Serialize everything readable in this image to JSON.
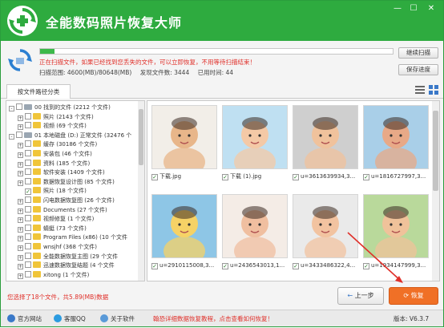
{
  "app": {
    "title": "全能数码照片恢复大师",
    "min_label": "—",
    "max_label": "☐",
    "close_label": "✕"
  },
  "scan": {
    "progress": 0.04,
    "status": "正在扫描文件，如果已经找到您丢失的文件，可以立即恢复，不用等待扫描结束！",
    "range": "扫描范围: 4600(MB)/80648(MB)",
    "found": "发现文件数: 3444",
    "elapsed": "已用时间: 44",
    "continue_label": "继续扫描",
    "save_label": "保存进度"
  },
  "tab": {
    "label": "按文件路径分类"
  },
  "tree": [
    {
      "label": "00 找到的文件  (2212 个文件)",
      "level": 0,
      "kind": "drive",
      "exp": "-"
    },
    {
      "label": "照片     (2143 个文件)",
      "level": 1,
      "kind": "folder",
      "exp": "+"
    },
    {
      "label": "视频     (69 个文件)",
      "level": 1,
      "kind": "folder",
      "exp": "+"
    },
    {
      "label": "01 本地磁盘 (D:) 正常文件  (32476 个",
      "level": 0,
      "kind": "drive",
      "exp": "-"
    },
    {
      "label": "缓存     (30186 个文件)",
      "level": 1,
      "kind": "folder",
      "exp": "+"
    },
    {
      "label": "安装包    (46 个文件)",
      "level": 1,
      "kind": "folder",
      "exp": "+"
    },
    {
      "label": "资料     (185 个文件)",
      "level": 1,
      "kind": "folder",
      "exp": "+"
    },
    {
      "label": "软件安装   (1409 个文件)",
      "level": 1,
      "kind": "folder",
      "exp": "+"
    },
    {
      "label": "数据恢复设计图   (85 个文件)",
      "level": 1,
      "kind": "folder",
      "exp": "+"
    },
    {
      "label": "照片     (18 个文件)",
      "level": 1,
      "kind": "folder",
      "exp": "",
      "checked": true
    },
    {
      "label": "闪电数据恢复图   (26 个文件)",
      "level": 1,
      "kind": "folder",
      "exp": "+"
    },
    {
      "label": "Documents    (27 个文件)",
      "level": 1,
      "kind": "folder",
      "exp": "+"
    },
    {
      "label": "视频修复    (1 个文件)",
      "level": 1,
      "kind": "folder",
      "exp": "+"
    },
    {
      "label": "蜻蜓     (73 个文件)",
      "level": 1,
      "kind": "folder",
      "exp": "+"
    },
    {
      "label": "Program Files (x86)   (10 个文件",
      "level": 1,
      "kind": "folder",
      "exp": "+"
    },
    {
      "label": "wnsjhf    (368 个文件)",
      "level": 1,
      "kind": "folder",
      "exp": "+"
    },
    {
      "label": "全能数据恢复主图   (29 个文件",
      "level": 1,
      "kind": "folder",
      "exp": "+"
    },
    {
      "label": "迅速数据恢复结题   (4 个文件",
      "level": 1,
      "kind": "folder",
      "exp": "+"
    },
    {
      "label": "xitong    (1 个文件)",
      "level": 1,
      "kind": "folder",
      "exp": "+"
    }
  ],
  "files": [
    {
      "name": "下载.jpg",
      "bg": "#f2eee8",
      "fg": "#e8b68a"
    },
    {
      "name": "下载 (1).jpg",
      "bg": "#bfe0f2",
      "fg": "#f4c9a6"
    },
    {
      "name": "u=3613639934,3...",
      "bg": "#cfcfcf",
      "fg": "#f0c29c"
    },
    {
      "name": "u=1816727997,3...",
      "bg": "#a9cfe8",
      "fg": "#e8a987"
    },
    {
      "name": "u=2910115008,3...",
      "bg": "#8ec6e6",
      "fg": "#f6d266"
    },
    {
      "name": "u=2436543013,1...",
      "bg": "#f4ece6",
      "fg": "#f0bfa0"
    },
    {
      "name": "u=3433486322,4...",
      "bg": "#eaeaea",
      "fg": "#f2c3a0"
    },
    {
      "name": "u=1934147999,3...",
      "bg": "#b9d99b",
      "fg": "#f0c29a"
    }
  ],
  "bottom": {
    "selected": "您选择了18个文件，共5.89(MB)数据",
    "prev_label": "上一步",
    "recover_label": "恢复"
  },
  "footer": {
    "website": "官方网站",
    "qq": "客服QQ",
    "about": "关于软件",
    "tutorial": "翰恐详细数据恢复教程，点击查看如何恢复！",
    "version": "版本: V6.3.7"
  }
}
